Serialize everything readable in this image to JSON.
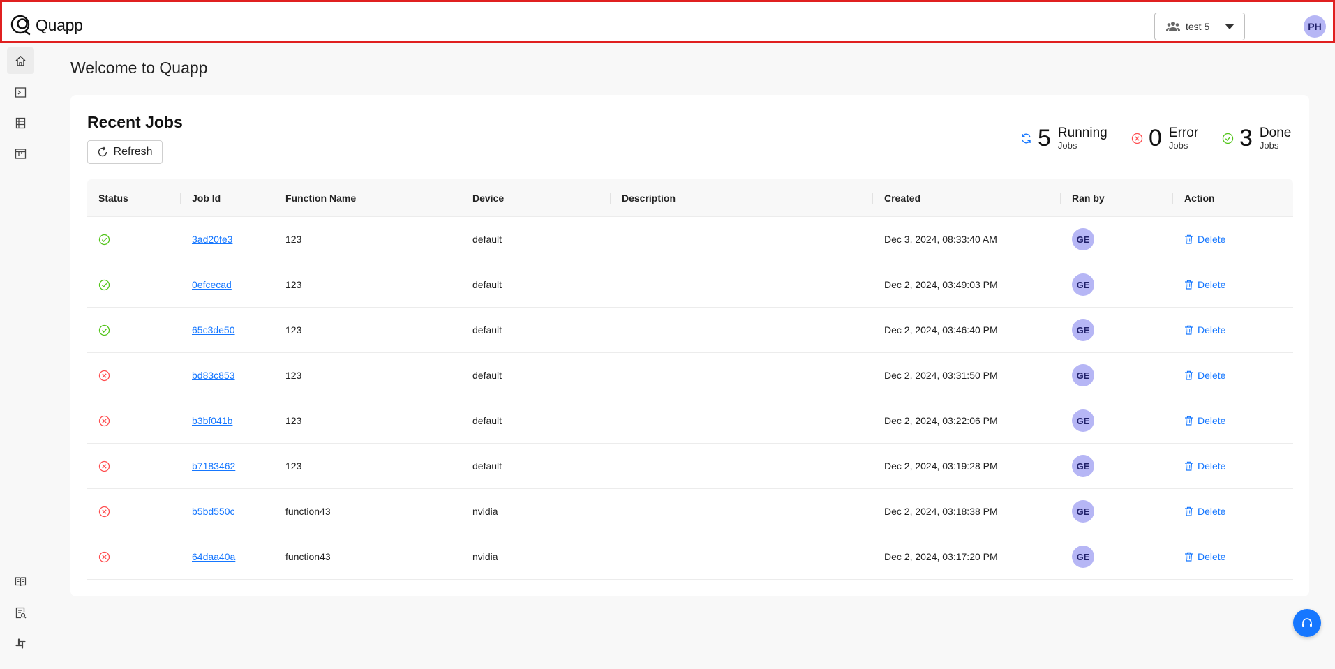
{
  "app": {
    "name": "Quapp"
  },
  "header": {
    "workspace": "test 5",
    "user_initials": "PH"
  },
  "sidebar": {
    "top_items": [
      "home-icon",
      "terminal-icon",
      "list-icon",
      "board-icon"
    ],
    "bottom_items": [
      "book-icon",
      "doc-search-icon",
      "slack-icon"
    ]
  },
  "main": {
    "title": "Welcome to Quapp",
    "card_title": "Recent Jobs",
    "refresh_label": "Refresh",
    "stats": [
      {
        "count": "5",
        "label": "Running",
        "sub": "Jobs",
        "color": "#1677ff"
      },
      {
        "count": "0",
        "label": "Error",
        "sub": "Jobs",
        "color": "#ff4d4f"
      },
      {
        "count": "3",
        "label": "Done",
        "sub": "Jobs",
        "color": "#52c41a"
      }
    ],
    "columns": [
      "Status",
      "Job Id",
      "Function Name",
      "Device",
      "Description",
      "Created",
      "Ran by",
      "Action"
    ],
    "delete_label": "Delete",
    "rows": [
      {
        "status": "done",
        "job_id": "3ad20fe3",
        "function": "123",
        "device": "default",
        "description": "",
        "created": "Dec 3, 2024, 08:33:40 AM",
        "ran_by": "GE"
      },
      {
        "status": "done",
        "job_id": "0efcecad",
        "function": "123",
        "device": "default",
        "description": "",
        "created": "Dec 2, 2024, 03:49:03 PM",
        "ran_by": "GE"
      },
      {
        "status": "done",
        "job_id": "65c3de50",
        "function": "123",
        "device": "default",
        "description": "",
        "created": "Dec 2, 2024, 03:46:40 PM",
        "ran_by": "GE"
      },
      {
        "status": "error",
        "job_id": "bd83c853",
        "function": "123",
        "device": "default",
        "description": "",
        "created": "Dec 2, 2024, 03:31:50 PM",
        "ran_by": "GE"
      },
      {
        "status": "error",
        "job_id": "b3bf041b",
        "function": "123",
        "device": "default",
        "description": "",
        "created": "Dec 2, 2024, 03:22:06 PM",
        "ran_by": "GE"
      },
      {
        "status": "error",
        "job_id": "b7183462",
        "function": "123",
        "device": "default",
        "description": "",
        "created": "Dec 2, 2024, 03:19:28 PM",
        "ran_by": "GE"
      },
      {
        "status": "error",
        "job_id": "b5bd550c",
        "function": "function43",
        "device": "nvidia",
        "description": "",
        "created": "Dec 2, 2024, 03:18:38 PM",
        "ran_by": "GE"
      },
      {
        "status": "error",
        "job_id": "64daa40a",
        "function": "function43",
        "device": "nvidia",
        "description": "",
        "created": "Dec 2, 2024, 03:17:20 PM",
        "ran_by": "GE"
      }
    ]
  },
  "colors": {
    "accent": "#1677ff",
    "done": "#52c41a",
    "error": "#ff4d4f",
    "avatar_bg": "#b6b6f5"
  }
}
